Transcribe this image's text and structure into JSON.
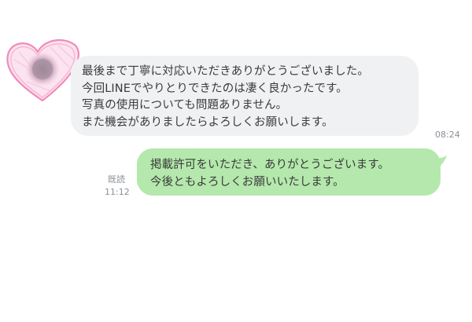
{
  "incoming_message": {
    "lines": [
      "最後まで丁寧に対応いただきありがとうございました。",
      "今回LINEでやりとりできたのは凄く良かったです。",
      "写真の使用についても問題ありません。",
      "また機会がありましたらよろしくお願いします。"
    ],
    "time": "08:24",
    "bubble_color": "#f0f1f3"
  },
  "outgoing_message": {
    "lines": [
      "掲載許可をいただき、ありがとうございます。",
      "今後ともよろしくお願いいたします。"
    ],
    "read_status": "既読",
    "time": "11:12",
    "bubble_color": "#b4e8ac"
  },
  "avatar": {
    "icon": "heart-avatar-icon",
    "color": "#f4a6c8"
  }
}
